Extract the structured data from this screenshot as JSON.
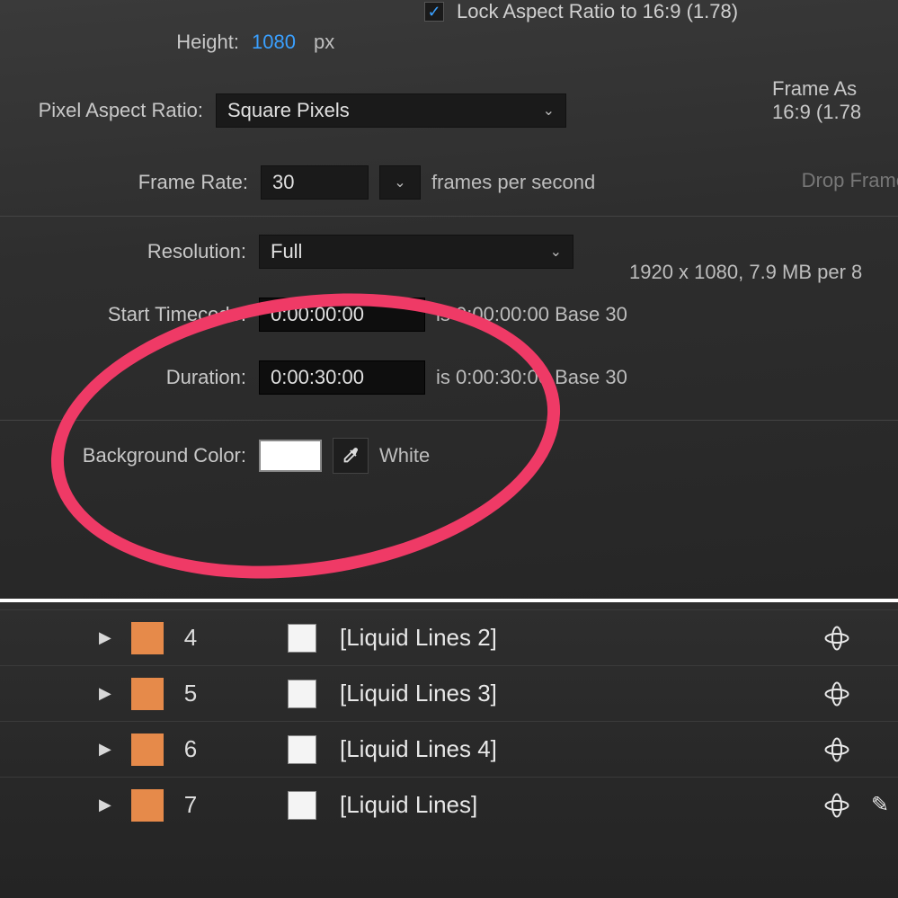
{
  "top": {
    "lock_label": "Lock Aspect Ratio to 16:9 (1.78)",
    "height_label": "Height:",
    "height_value": "1080",
    "height_unit": "px",
    "par_label": "Pixel Aspect Ratio:",
    "par_value": "Square Pixels",
    "frame_aspect_label": "Frame As",
    "frame_aspect_value": "16:9 (1.78",
    "framerate_label": "Frame Rate:",
    "framerate_value": "30",
    "framerate_unit": "frames per second",
    "dropframe_label": "Drop Frame",
    "resolution_label": "Resolution:",
    "resolution_value": "Full",
    "resolution_info": "1920 x 1080, 7.9 MB per 8",
    "start_tc_label": "Start Timecode:",
    "start_tc_value": "0:00:00:00",
    "start_tc_info": "is 0:00:00:00  Base 30",
    "duration_label": "Duration:",
    "duration_value": "0:00:30:00",
    "duration_info": "is 0:00:30:00  Base 30",
    "bg_label": "Background Color:",
    "bg_name": "White"
  },
  "layers": [
    {
      "num": "4",
      "name": "[Liquid Lines 2]"
    },
    {
      "num": "5",
      "name": "[Liquid Lines 3]"
    },
    {
      "num": "6",
      "name": "[Liquid Lines 4]"
    },
    {
      "num": "7",
      "name": "[Liquid Lines]"
    }
  ]
}
